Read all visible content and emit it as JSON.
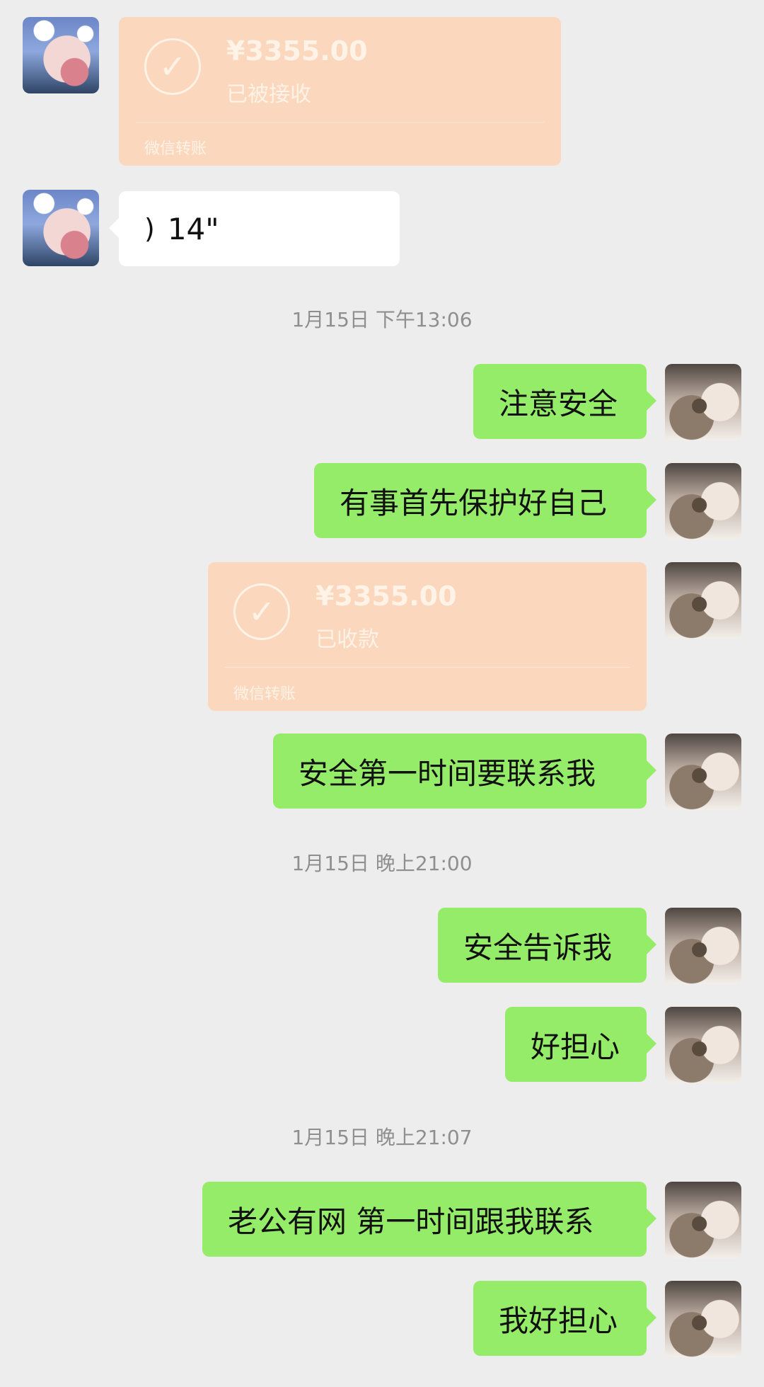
{
  "colors": {
    "background": "#ededed",
    "green_bubble": "#95ec69",
    "white_bubble": "#ffffff",
    "transfer_card": "#fbd8bd"
  },
  "messages": {
    "m1": {
      "amount": "¥3355.00",
      "status": "已被接收",
      "footer": "微信转账"
    },
    "m2": {
      "voice_icon": "voice-icon",
      "duration": "14\""
    },
    "ts1": "1月15日 下午13:06",
    "m3": "注意安全",
    "m4": "有事首先保护好自己",
    "m5": {
      "amount": "¥3355.00",
      "status": "已收款",
      "footer": "微信转账"
    },
    "m6": "安全第一时间要联系我",
    "ts2": "1月15日 晚上21:00",
    "m7": "安全告诉我",
    "m8": "好担心",
    "ts3": "1月15日 晚上21:07",
    "m9": "老公有网 第一时间跟我联系",
    "m10": "我好担心"
  }
}
